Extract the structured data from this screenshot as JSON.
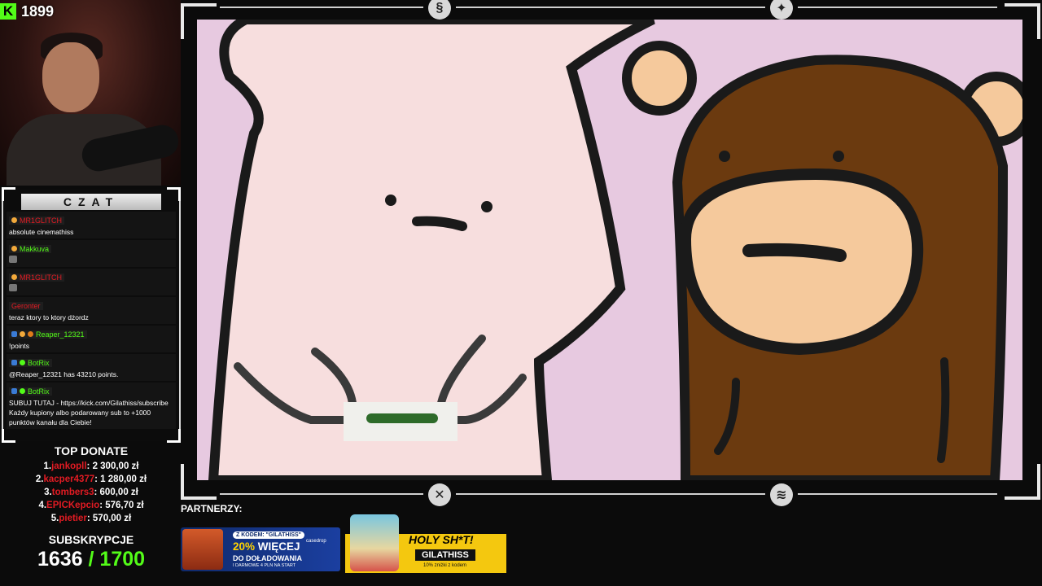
{
  "kick": {
    "viewer_count": "1899",
    "logo_letter": "K",
    "brand_color": "#53fc18"
  },
  "chat": {
    "header": "CZAT",
    "messages": [
      {
        "user": "MR1GLITCH",
        "user_color": "#e31b23",
        "text": "absolute cinemathiss",
        "emote_only": false
      },
      {
        "user": "Makkuva",
        "user_color": "#53fc18",
        "text": "",
        "emote_only": true
      },
      {
        "user": "MR1GLITCH",
        "user_color": "#e31b23",
        "text": "",
        "emote_only": true
      },
      {
        "user": "Geronter",
        "user_color": "#e31b23",
        "text": "teraz ktory to ktory dżordz",
        "emote_only": false
      },
      {
        "user": "Reaper_12321",
        "user_color": "#53fc18",
        "text": "!points",
        "emote_only": false
      },
      {
        "user": "BotRix",
        "user_color": "#53fc18",
        "text": "@Reaper_12321 has 43210 points.",
        "emote_only": false
      },
      {
        "user": "BotRix",
        "user_color": "#53fc18",
        "text": "SUBUJ TUTAJ - https://kick.com/Gilathiss/subscribe Każdy kupiony albo podarowany sub to +1000 punktów kanału dla Ciebie!",
        "emote_only": false
      }
    ]
  },
  "top_donate": {
    "title": "TOP DONATE",
    "entries": [
      {
        "rank": "1.",
        "name": "jankopll",
        "amount": ": 2 300,00 zł"
      },
      {
        "rank": "2.",
        "name": "kacper4377",
        "amount": ": 1 280,00 zł"
      },
      {
        "rank": "3.",
        "name": "tombers3",
        "amount": ": 600,00 zł"
      },
      {
        "rank": "4.",
        "name": "EPICKepcio",
        "amount": ": 576,70 zł"
      },
      {
        "rank": "5.",
        "name": "pietier",
        "amount": ": 570,00 zł"
      }
    ]
  },
  "subs": {
    "title": "SUBSKRYPCJE",
    "current": "1636",
    "goal": "/ 1700"
  },
  "partners": {
    "label": "PARTNERZY:",
    "casedrop": {
      "code": "Z KODEM: \"GILATHISS\"",
      "brand": "casedrop",
      "headline_pct": "20%",
      "headline_rest": " WIĘCEJ",
      "line2": "DO DOŁADOWANIA",
      "line3": "I DARMOWE 4 PLN NA START"
    },
    "holy": {
      "title": "HOLY SH*T!",
      "code": "GILATHISS",
      "sub": "10% zniżki z kodem"
    }
  },
  "colors": {
    "video_bg": "#e7c9e0",
    "pink_char": "#f7dede",
    "bear_brown": "#6b3a0f",
    "bear_face": "#f5c99c",
    "outline": "#1a1a1a"
  }
}
